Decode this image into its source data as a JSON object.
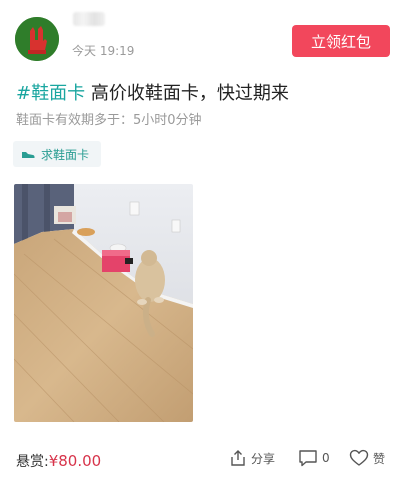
{
  "header": {
    "time": "今天 19:19",
    "red_packet_button": "立领红包"
  },
  "post": {
    "topic": "#鞋面卡",
    "text": " 高价收鞋面卡，快过期来",
    "validity": "鞋面卡有效期多于：5小时0分钟"
  },
  "tag": {
    "label": "求鞋面卡",
    "icon": "sneaker-icon"
  },
  "footer": {
    "bounty_label": "悬赏:",
    "bounty_amount": "¥80.00",
    "share_label": "分享",
    "comment_count": "0",
    "like_label": "赞"
  },
  "colors": {
    "accent_red": "#f2475c",
    "topic_teal": "#1aa6a0",
    "price_red": "#d7334a",
    "avatar_green": "#2f7d2a"
  }
}
